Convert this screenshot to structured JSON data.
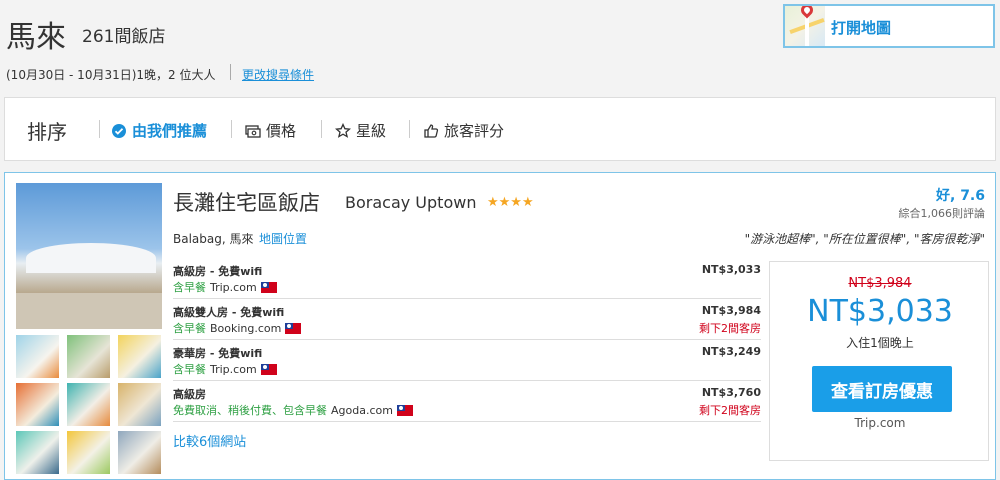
{
  "search": {
    "destination": "馬來",
    "count": "261間飯店",
    "dates_guests": "(10月30日 - 10月31日)1晚，2 位大人",
    "change_link": "更改搜尋條件",
    "map_button": "打開地圖"
  },
  "sort": {
    "label": "排序",
    "options": [
      {
        "label": "由我們推薦",
        "icon": "check-circle-icon",
        "active": true
      },
      {
        "label": "價格",
        "icon": "banknote-icon",
        "active": false
      },
      {
        "label": "星級",
        "icon": "star-icon",
        "active": false
      },
      {
        "label": "旅客評分",
        "icon": "thumbs-up-icon",
        "active": false
      }
    ]
  },
  "hotel": {
    "name_zh": "長灘住宅區飯店",
    "name_en": "Boracay Uptown",
    "stars": "★★★★",
    "rating": "好, 7.6",
    "reviews": "綜合1,066則評論",
    "location": "Balabag, 馬來",
    "map_link": "地圖位置",
    "quotes": "\"游泳池超棒\", \"所在位置很棒\", \"客房很乾淨\"",
    "rooms": [
      {
        "title": "高級房 - 免費wifi",
        "perks": "含早餐",
        "provider": "Trip.com",
        "price": "NT$3,033",
        "left": ""
      },
      {
        "title": "高級雙人房 - 免費wifi",
        "perks": "含早餐",
        "provider": "Booking.com",
        "price": "NT$3,984",
        "left": "剩下2間客房"
      },
      {
        "title": "豪華房 - 免費wifi",
        "perks": "含早餐",
        "provider": "Trip.com",
        "price": "NT$3,249",
        "left": ""
      },
      {
        "title": "高級房",
        "perks": "免費取消、稍後付費、包含早餐",
        "provider": "Agoda.com",
        "price": "NT$3,760",
        "left": "剩下2間客房"
      }
    ],
    "compare_link": "比較6個網站",
    "deal": {
      "old_price": "NT$3,984",
      "new_price": "NT$3,033",
      "per_night": "入住1個晚上",
      "button": "查看訂房優惠",
      "provider": "Trip.com"
    }
  },
  "colors": {
    "accent": "#1a8fd8",
    "cta": "#1a9ee8",
    "green": "#2ea043",
    "red": "#d0021b",
    "star": "#f5a623"
  }
}
